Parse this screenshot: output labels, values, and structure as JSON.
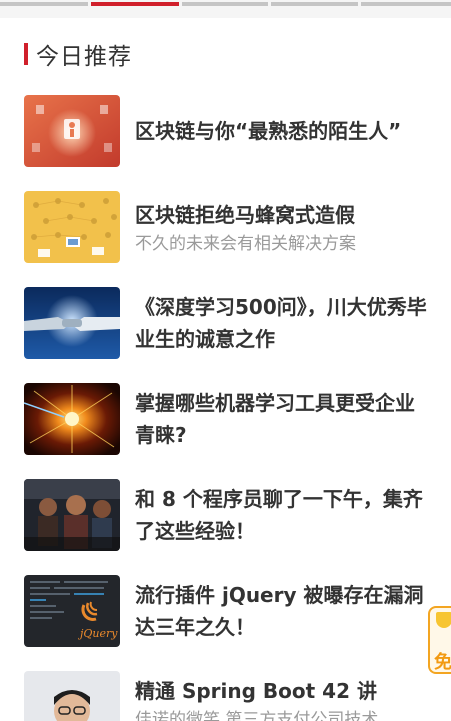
{
  "section": {
    "title": "今日推荐"
  },
  "tabs": [
    {
      "active": false
    },
    {
      "active": true
    },
    {
      "active": false
    },
    {
      "active": false
    },
    {
      "active": false
    }
  ],
  "articles": [
    {
      "title": "区块链与你“最熟悉的陌生人”",
      "subtitle": "",
      "thumb": "blockchain-person-thumbnail"
    },
    {
      "title": "区块链拒绝马蜂窝式造假",
      "subtitle": "不久的未来会有相关解决方案",
      "thumb": "isometric-network-thumbnail"
    },
    {
      "title": "《深度学习500问》，川大优秀毕业生的诚意之作",
      "subtitle": "",
      "thumb": "robot-handshake-thumbnail"
    },
    {
      "title": "掌握哪些机器学习工具更受企业青睐?",
      "subtitle": "",
      "thumb": "energy-burst-thumbnail"
    },
    {
      "title": "和 8 个程序员聊了一下午，集齐了这些经验！",
      "subtitle": "",
      "thumb": "programmers-photo-thumbnail"
    },
    {
      "title": "流行插件 jQuery 被曝存在漏洞达三年之久！",
      "subtitle": "",
      "thumb": "jquery-logo-thumbnail"
    },
    {
      "title": "精通 Spring Boot 42 讲",
      "subtitle": "佳诺的微笑 第三方支付公司技术",
      "thumb": "author-portrait-thumbnail"
    }
  ],
  "float_badge": {
    "label": "免"
  },
  "colors": {
    "accent": "#d0202b",
    "title": "#333333",
    "subtitle": "#9a9a9a",
    "badge": "#f3a521"
  }
}
